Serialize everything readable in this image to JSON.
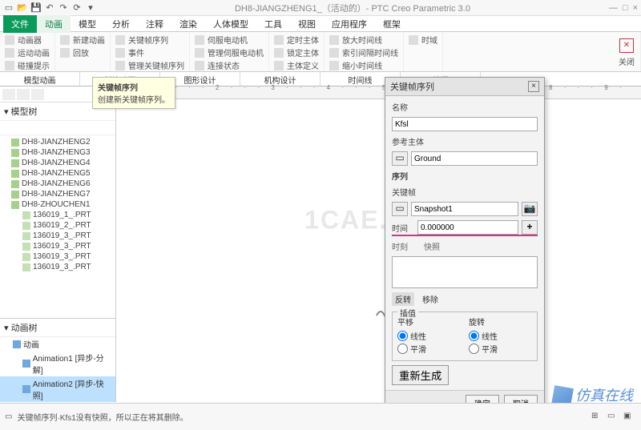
{
  "window": {
    "title": "DH8-JIANGZHENG1_（活动的）- PTC Creo Parametric 3.0",
    "min": "—",
    "max": "□",
    "close": "×"
  },
  "menu": {
    "file": "文件",
    "items": [
      "动画",
      "模型",
      "分析",
      "注释",
      "渲染",
      "人体模型",
      "工具",
      "视图",
      "应用程序",
      "框架"
    ]
  },
  "ribbon": {
    "g1": {
      "l1": "动画器",
      "l2": "运动动画",
      "l3": "碰撞提示"
    },
    "g2": {
      "l1": "新建动画",
      "l2": "回放"
    },
    "g3": {
      "l1": "关键帧序列",
      "l2": "事件",
      "l3": "管理关键帧序列"
    },
    "g4": {
      "l1": "伺服电动机",
      "l2": "管理伺服电动机",
      "l3": "连接状态"
    },
    "g5": {
      "l1": "定时主体",
      "l2": "锁定主体",
      "l3": "主体定义"
    },
    "g6": {
      "l1": "放大时间线",
      "l2": "索引间隔时间线",
      "l3": "缩小时间线"
    },
    "g7": {
      "l1": "时域"
    },
    "close": "关闭"
  },
  "ribbon_tabs": [
    "模型动画",
    "创建动画",
    "图形设计",
    "机构设计",
    "时间线",
    "关闭"
  ],
  "ribbon_tab_active": "创建动画",
  "tooltip": {
    "title": "关键帧序列",
    "desc": "创建新关键帧序列。"
  },
  "sidebar": {
    "head": "模型树",
    "nodes": [
      "DH8-JIANZHENG2",
      "DH8-JIANZHENG3",
      "DH8-JIANZHENG4",
      "DH8-JIANZHENG5",
      "DH8-JIANZHENG6",
      "DH8-JIANZHENG7",
      "DH8-ZHOUCHEN1"
    ],
    "subnodes": [
      "136019_1_.PRT",
      "136019_2_.PRT",
      "136019_3_.PRT",
      "136019_3_.PRT",
      "136019_3_.PRT",
      "136019_3_.PRT"
    ],
    "animhead": "动画树",
    "animroot": "动画",
    "anim1": "Animation1 [异步-分解]",
    "anim2": "Animation2 [异步-快照]"
  },
  "canvas": {
    "watermark": "1CAE.COM",
    "ruler": "· · · 1 · · · 2 · · · 3 · · · 4 · · · 5 · · · 6 · · · 7 · · · 8 · · · 9 · · · 10"
  },
  "dialog": {
    "title": "关键帧序列",
    "name_lbl": "名称",
    "name_val": "Kfsl",
    "ref_lbl": "参考主体",
    "ref_val": "Ground",
    "seq_lbl": "序列",
    "kfz_lbl": "关键帧",
    "kfz_val": "Snapshot1",
    "time_lbl": "时间",
    "time_val": "0.000000",
    "cols_lbl1": "时刻",
    "cols_lbl2": "快照",
    "tab_rev": "反转",
    "tab_rem": "移除",
    "grp_title": "插值",
    "col1_title": "平移",
    "col2_title": "旋转",
    "opt_linear": "线性",
    "opt_smooth": "平滑",
    "regen": "重新生成",
    "ok": "确定",
    "cancel": "取消"
  },
  "status": {
    "msg": "关键帧序列·Kfs1没有快照，所以正在将其删除。"
  },
  "brand": "仿真在线"
}
